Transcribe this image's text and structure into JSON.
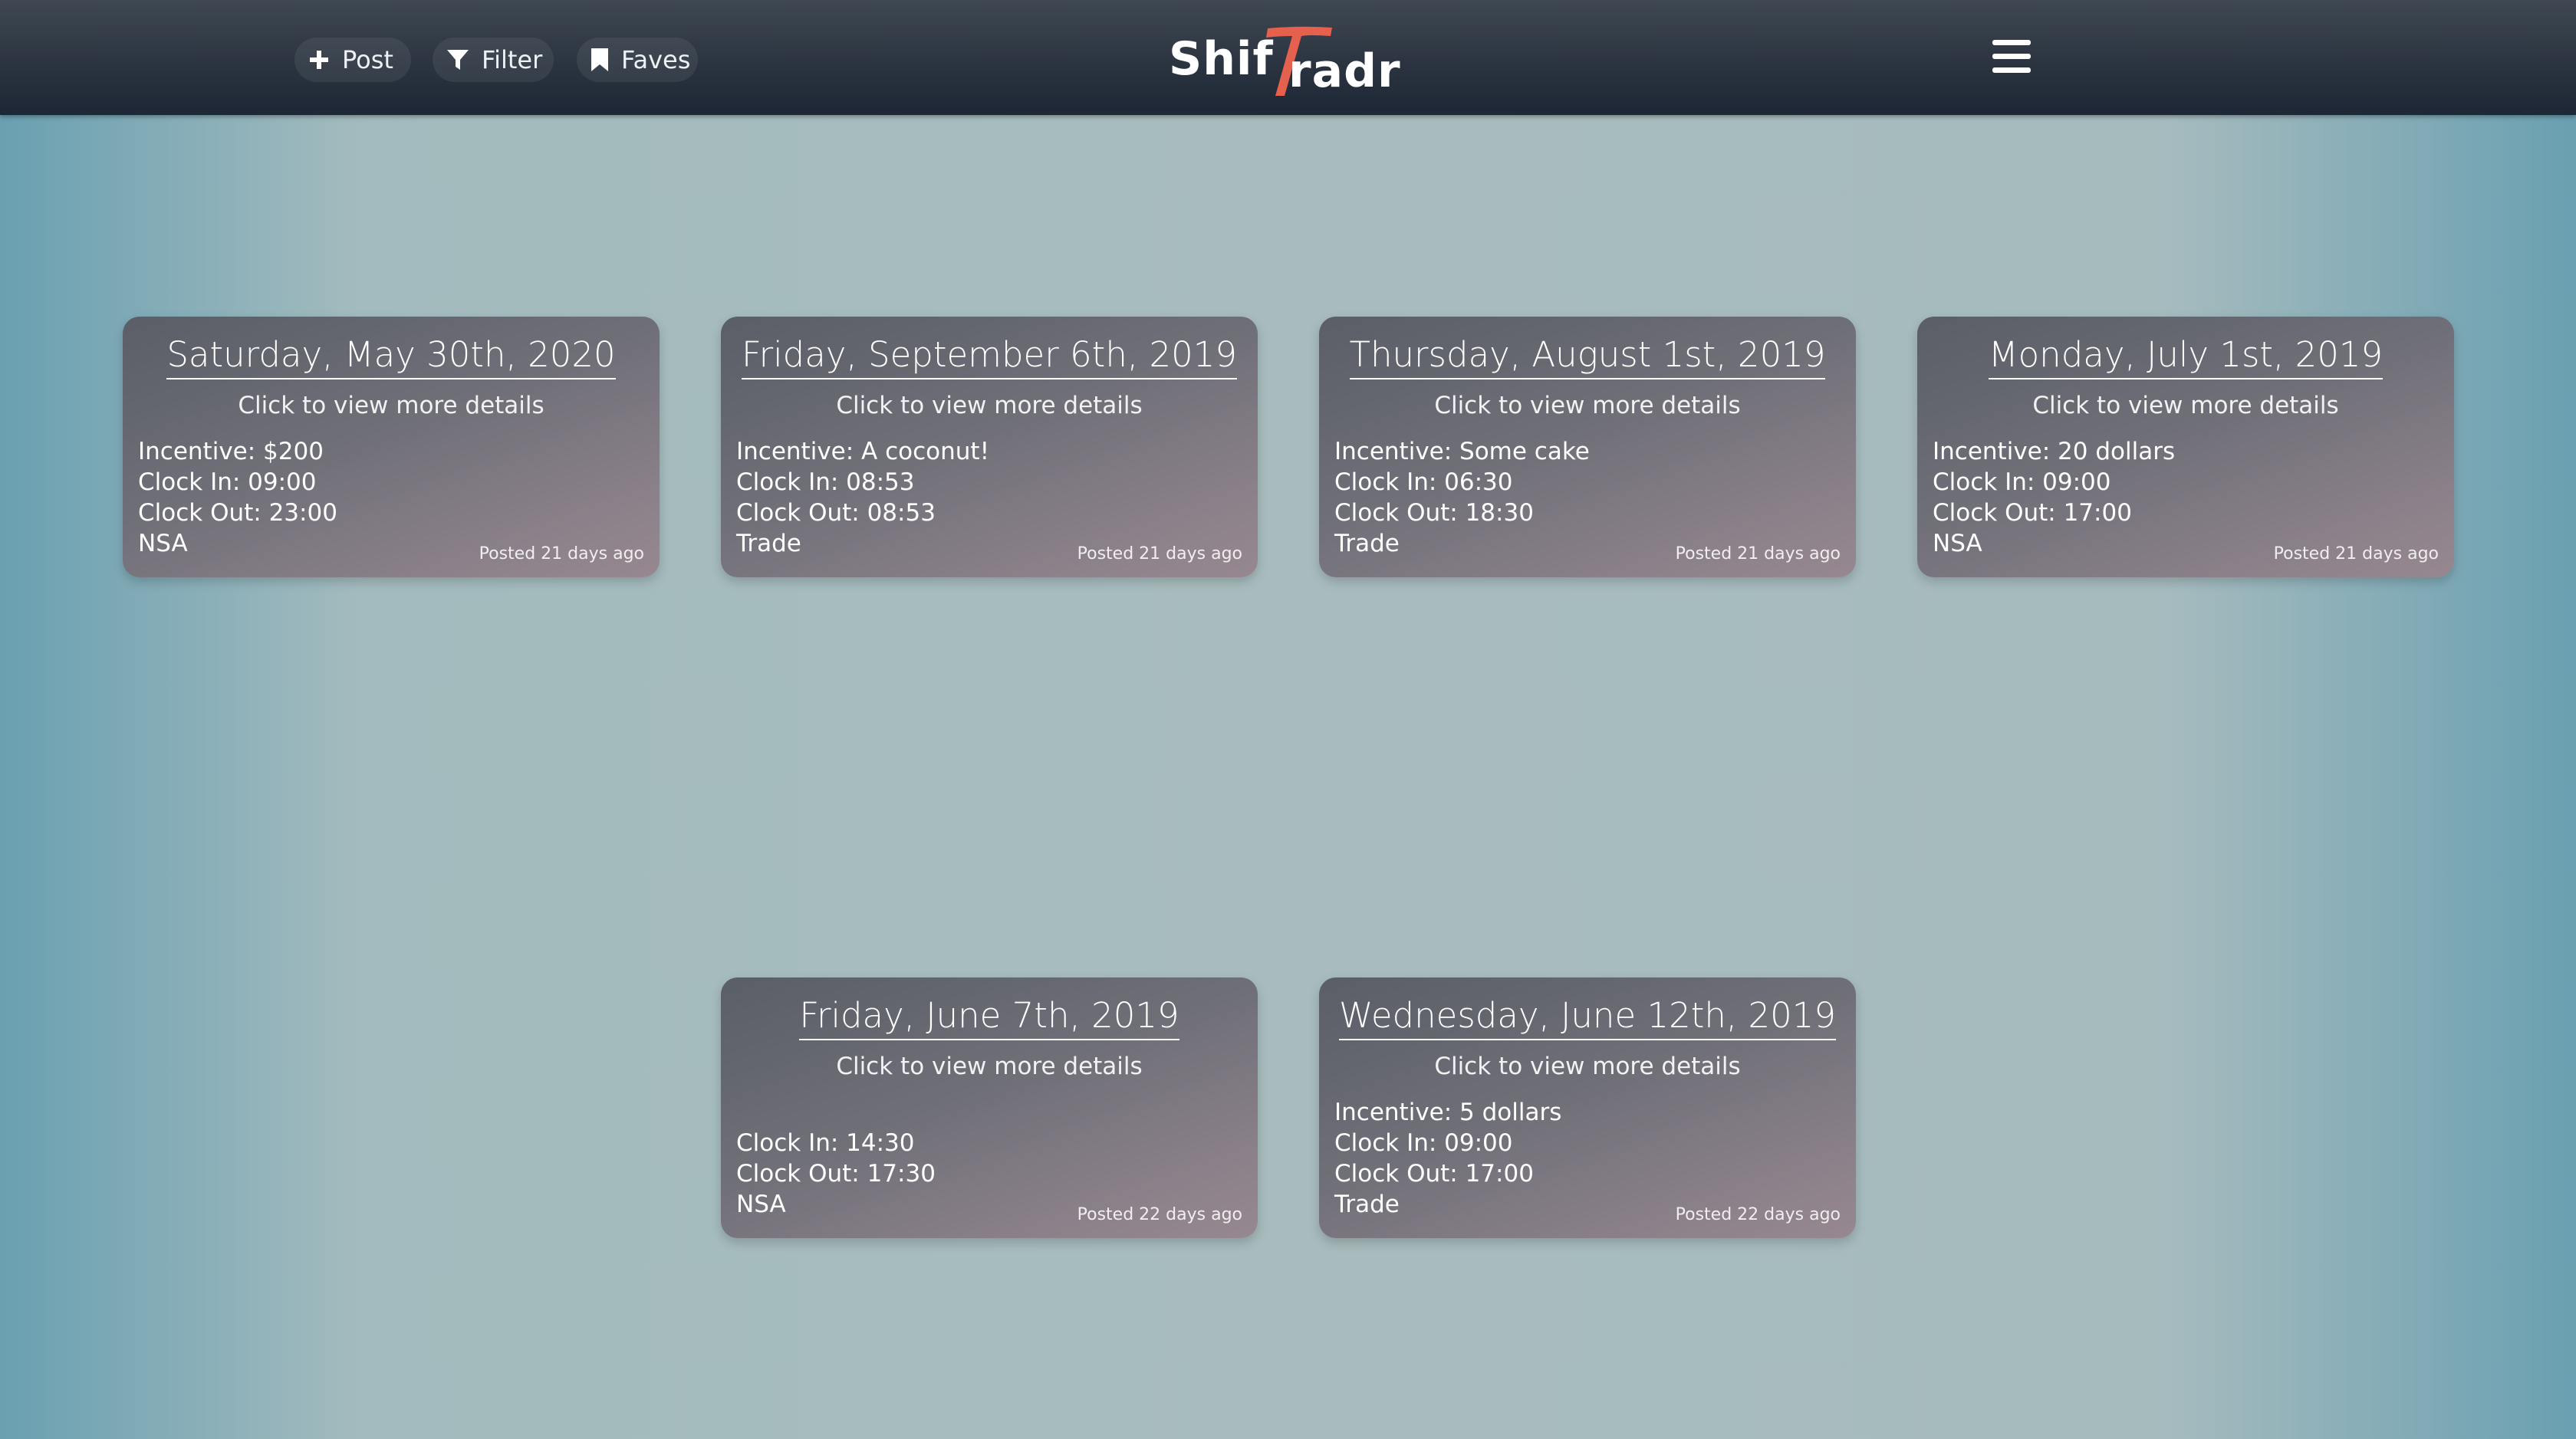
{
  "header": {
    "post_label": "Post",
    "filter_label": "Filter",
    "faves_label": "Faves",
    "logo_part1": "Shif",
    "logo_part2": "radr",
    "logo_accent": "#e5604d"
  },
  "cards": [
    {
      "date": "Saturday, May 30th, 2020",
      "hint": "Click to view more details",
      "incentive": "Incentive: $200",
      "clock_in": "Clock In: 09:00",
      "clock_out": "Clock Out: 23:00",
      "type": "NSA",
      "posted": "Posted 21 days ago"
    },
    {
      "date": "Friday, September 6th, 2019",
      "hint": "Click to view more details",
      "incentive": "Incentive: A coconut!",
      "clock_in": "Clock In: 08:53",
      "clock_out": "Clock Out: 08:53",
      "type": "Trade",
      "posted": "Posted 21 days ago"
    },
    {
      "date": "Thursday, August 1st, 2019",
      "hint": "Click to view more details",
      "incentive": "Incentive: Some cake",
      "clock_in": "Clock In: 06:30",
      "clock_out": "Clock Out: 18:30",
      "type": "Trade",
      "posted": "Posted 21 days ago"
    },
    {
      "date": "Monday, July 1st, 2019",
      "hint": "Click to view more details",
      "incentive": "Incentive: 20 dollars",
      "clock_in": "Clock In: 09:00",
      "clock_out": "Clock Out: 17:00",
      "type": "NSA",
      "posted": "Posted 21 days ago"
    },
    {
      "date": "Friday, June 7th, 2019",
      "hint": "Click to view more details",
      "clock_in": "Clock In: 14:30",
      "clock_out": "Clock Out: 17:30",
      "type": "NSA",
      "posted": "Posted 22 days ago"
    },
    {
      "date": "Wednesday, June 12th, 2019",
      "hint": "Click to view more details",
      "incentive": "Incentive: 5 dollars",
      "clock_in": "Clock In: 09:00",
      "clock_out": "Clock Out: 17:00",
      "type": "Trade",
      "posted": "Posted 22 days ago"
    }
  ]
}
